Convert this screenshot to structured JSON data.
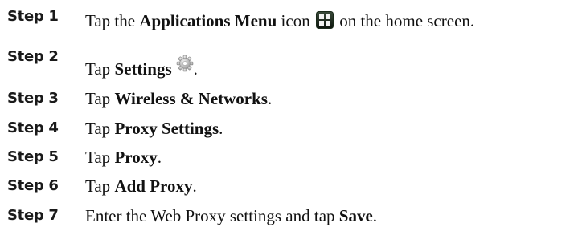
{
  "steps": [
    {
      "label": "Step 1",
      "pre": "Tap the ",
      "bold": "Applications Menu",
      "mid": " icon",
      "icon": "applications-menu-icon",
      "post": " on the home screen."
    },
    {
      "label": "Step 2",
      "pre": "Tap ",
      "bold": "Settings",
      "icon": "settings-gear-icon",
      "post": "."
    },
    {
      "label": "Step 3",
      "pre": "Tap ",
      "bold": "Wireless & Networks",
      "post": "."
    },
    {
      "label": "Step 4",
      "pre": "Tap ",
      "bold": "Proxy Settings",
      "post": "."
    },
    {
      "label": "Step 5",
      "pre": "Tap ",
      "bold": "Proxy",
      "post": "."
    },
    {
      "label": "Step 6",
      "pre": "Tap ",
      "bold": "Add Proxy",
      "post": "."
    },
    {
      "label": "Step 7",
      "pre": "Enter the Web Proxy settings and tap ",
      "bold": "Save",
      "post": "."
    }
  ]
}
